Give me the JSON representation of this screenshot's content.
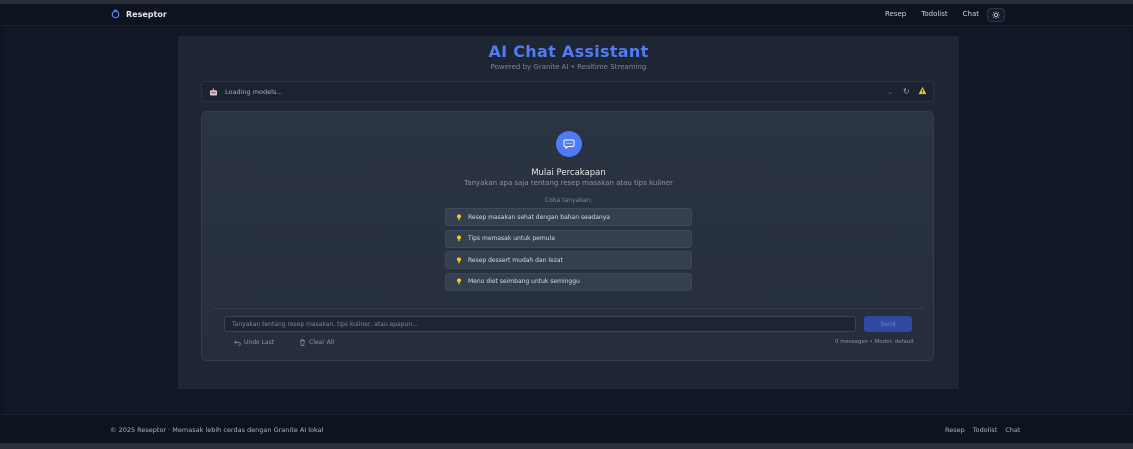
{
  "nav": {
    "brand": "Reseptor",
    "links": [
      "Resep",
      "Todolist",
      "Chat"
    ],
    "theme_icon": "sun-icon"
  },
  "header": {
    "title": "AI Chat Assistant",
    "subtitle": "Powered by Granite AI • Realtime Streaming"
  },
  "model_selector": {
    "value": "Loading models...",
    "icon": "robot-icon",
    "status_icon": "warning-icon"
  },
  "welcome": {
    "title": "Mulai Percakapan",
    "subtitle": "Tanyakan apa saja tentang resep masakan atau tips kuliner",
    "try_label": "Coba tanyakan:",
    "suggestions": [
      "Resep masakan sehat dengan bahan seadanya",
      "Tips memasak untuk pemula",
      "Resep dessert mudah dan lezat",
      "Menu diet seimbang untuk seminggu"
    ]
  },
  "composer": {
    "placeholder": "Tanyakan tentang resep masakan, tips kuliner, atau apapun...",
    "send_label": "Send",
    "undo_label": "Undo Last",
    "clear_label": "Clear All",
    "meta": "0 messages • Model: default"
  },
  "footer": {
    "text": "© 2025 Reseptor · Memasak lebih cerdas dengan Granite AI lokal",
    "links": [
      "Resep",
      "Todolist",
      "Chat"
    ]
  },
  "colors": {
    "accent": "#4f7cf5",
    "background": "#0f1420",
    "card": "#2b3442",
    "warning": "#f5c518"
  }
}
